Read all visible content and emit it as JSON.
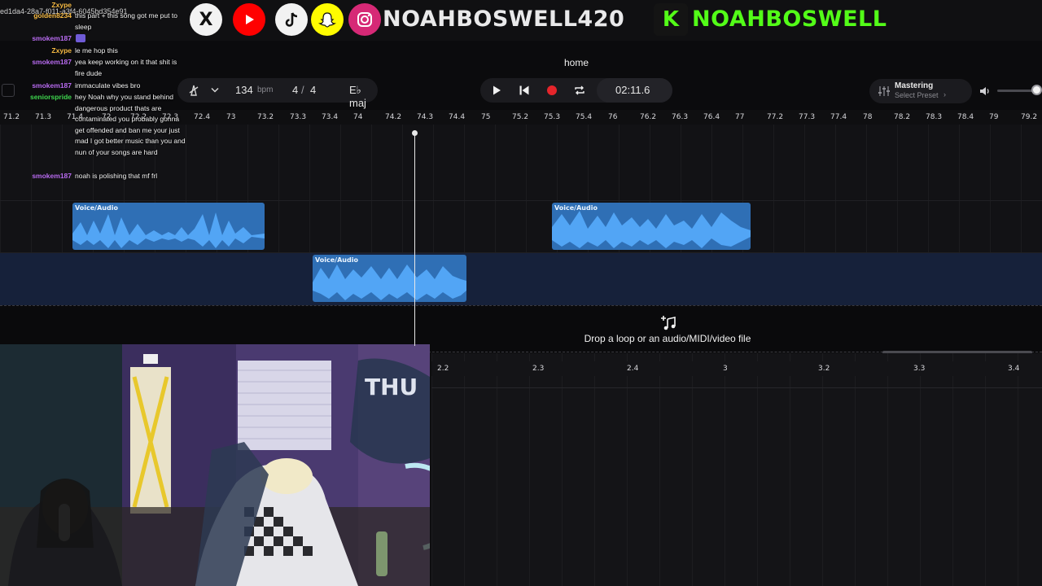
{
  "banner": {
    "handle": "NOAHBOSWELL420",
    "kick_handle": "NOAHBOSWELL",
    "kick_letter": "K",
    "social_icons": [
      "x-icon",
      "youtube-icon",
      "tiktok-icon",
      "snapchat-icon",
      "instagram-icon",
      "kick-icon"
    ],
    "colors": {
      "handle": "#e9e9ea",
      "kick_green": "#53fc18",
      "youtube_red": "#ff0000",
      "snapchat_yellow": "#fffc00"
    }
  },
  "app": {
    "title": "home",
    "accent": "#3f8fe0"
  },
  "toolbar": {
    "bpm_value": "134",
    "bpm_unit": "bpm",
    "time_sig_top": "4",
    "time_sig_sep": "/",
    "time_sig_bottom": "4",
    "key": "E♭ maj",
    "time": "02:11.6",
    "mastering_label": "Mastering",
    "mastering_preset": "Select Preset"
  },
  "ruler": {
    "ticks": [
      "71.2",
      "71.3",
      "71.4",
      "72",
      "72.2",
      "72.3",
      "72.4",
      "73",
      "73.2",
      "73.3",
      "73.4",
      "74",
      "74.2",
      "74.3",
      "74.4",
      "75",
      "75.2",
      "75.3",
      "75.4",
      "76",
      "76.2",
      "76.3",
      "76.4",
      "77",
      "77.2",
      "77.3",
      "77.4",
      "78",
      "78.2",
      "78.3",
      "78.4",
      "79",
      "79.2"
    ]
  },
  "tracks": {
    "clips": [
      {
        "label": "Voice/Audio",
        "lane": 1
      },
      {
        "label": "Voice/Audio",
        "lane": 1
      },
      {
        "label": "Voice/Audio",
        "lane": 2
      }
    ]
  },
  "dropzone": {
    "text": "Drop a loop or an audio/MIDI/video file",
    "icon": "add-music-note-icon"
  },
  "editor_ruler": {
    "ticks": [
      "2.2",
      "2.3",
      "2.4",
      "3",
      "3.2",
      "3.3",
      "3.4"
    ]
  },
  "chat": {
    "messages": [
      {
        "user": "Zxype",
        "user_color": "#f5b942",
        "text": ""
      },
      {
        "user": "golden8234",
        "user_color": "#f5b942",
        "text": "this part + this song got me put to sleep"
      },
      {
        "user": "smokem187",
        "user_color": "#b86bf0",
        "text": ""
      },
      {
        "user": "Zxype",
        "user_color": "#f5b942",
        "text": "le me hop this"
      },
      {
        "user": "smokem187",
        "user_color": "#b86bf0",
        "text": "yea keep working on it that shit is fire dude"
      },
      {
        "user": "smokem187",
        "user_color": "#b86bf0",
        "text": "immaculate vibes bro"
      },
      {
        "user": "seniorspride",
        "user_color": "#3fd64e",
        "text": "hey Noah why you stand behind dangerous product thats are contaminated you probably gonna get offended and ban me your just mad I got better music than you and nun of your songs are hard"
      },
      {
        "user": "smokem187",
        "user_color": "#b86bf0",
        "text": "noah is polishing that mf frl"
      }
    ],
    "overlay_id": "ed1da4-28a7-f011-a3f4-6045bd354e91"
  }
}
